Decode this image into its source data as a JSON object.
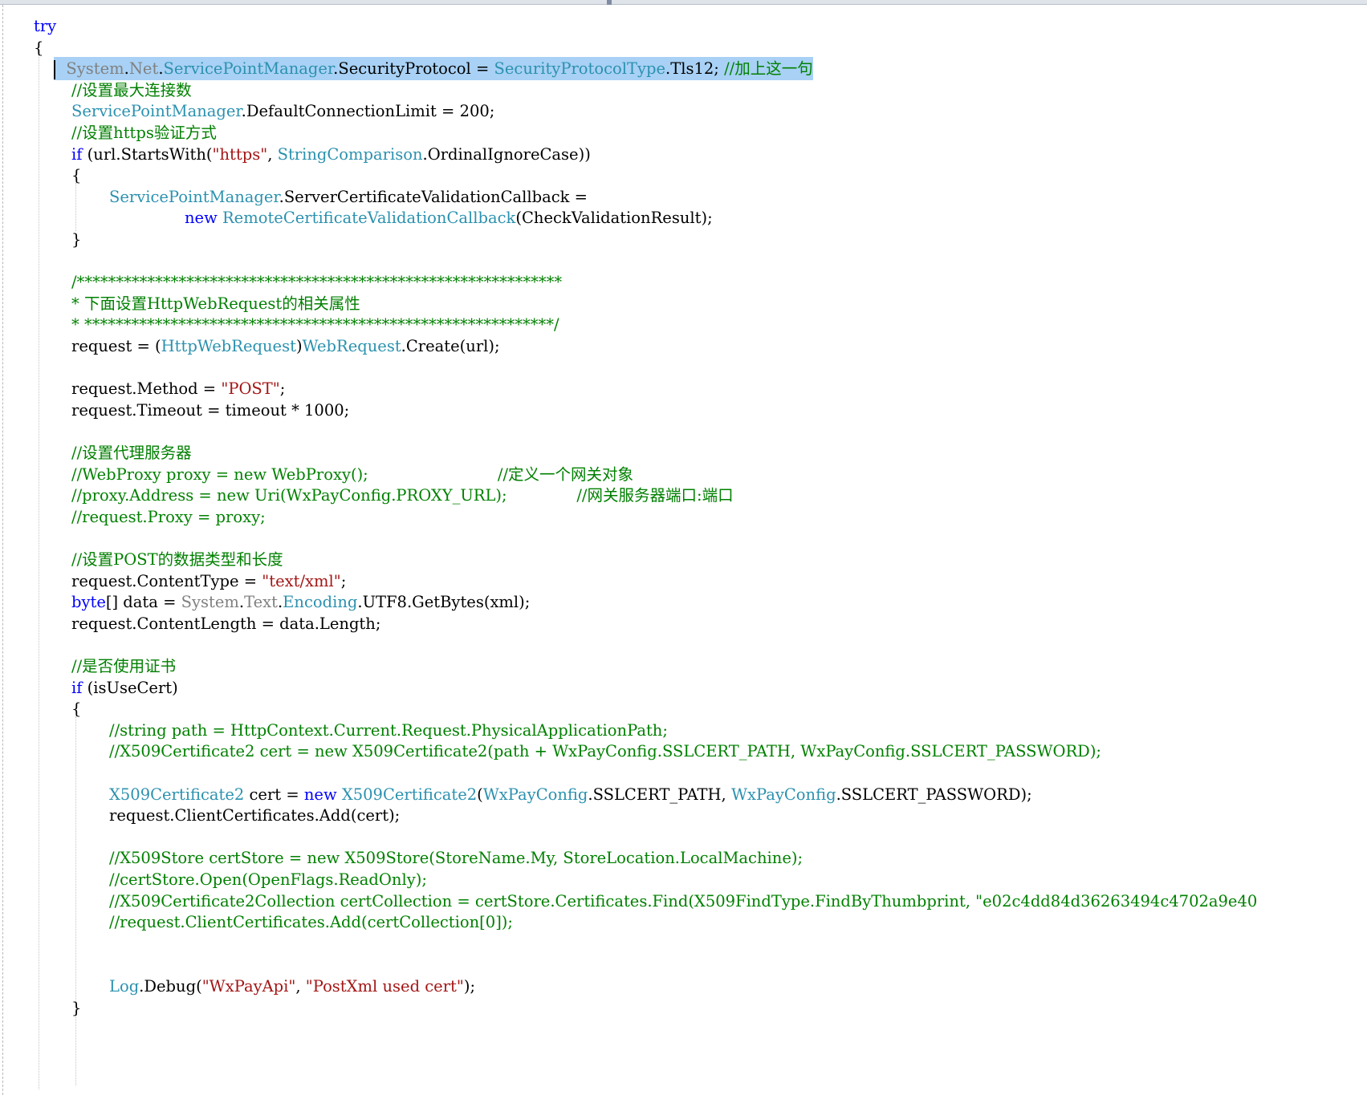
{
  "colors": {
    "keyword": "#0000ff",
    "type": "#2b91af",
    "string": "#a31515",
    "comment": "#008000",
    "namespace": "#808080",
    "plain": "#000000",
    "selection": "#a8d1f5",
    "background": "#ffffff"
  },
  "lines": [
    {
      "indent": 0,
      "segs": [
        {
          "t": "try",
          "c": "kw"
        }
      ]
    },
    {
      "indent": 0,
      "segs": [
        {
          "t": "{",
          "c": "pl"
        }
      ]
    },
    {
      "indent": 1,
      "selected": true,
      "caret": true,
      "segs": [
        {
          "t": "System",
          "c": "gr"
        },
        {
          "t": ".",
          "c": "pl"
        },
        {
          "t": "Net",
          "c": "gr"
        },
        {
          "t": ".",
          "c": "pl"
        },
        {
          "t": "ServicePointManager",
          "c": "ty"
        },
        {
          "t": ".SecurityProtocol = ",
          "c": "pl"
        },
        {
          "t": "SecurityProtocolType",
          "c": "ty"
        },
        {
          "t": ".Tls12; ",
          "c": "pl"
        },
        {
          "t": "//加上这一句",
          "c": "cm"
        }
      ]
    },
    {
      "indent": 1,
      "segs": [
        {
          "t": "//设置最大连接数",
          "c": "cm"
        }
      ]
    },
    {
      "indent": 1,
      "segs": [
        {
          "t": "ServicePointManager",
          "c": "ty"
        },
        {
          "t": ".DefaultConnectionLimit = 200;",
          "c": "pl"
        }
      ]
    },
    {
      "indent": 1,
      "segs": [
        {
          "t": "//设置https验证方式",
          "c": "cm"
        }
      ]
    },
    {
      "indent": 1,
      "segs": [
        {
          "t": "if",
          "c": "kw"
        },
        {
          "t": " (url.StartsWith(",
          "c": "pl"
        },
        {
          "t": "\"https\"",
          "c": "str"
        },
        {
          "t": ", ",
          "c": "pl"
        },
        {
          "t": "StringComparison",
          "c": "ty"
        },
        {
          "t": ".OrdinalIgnoreCase))",
          "c": "pl"
        }
      ]
    },
    {
      "indent": 1,
      "segs": [
        {
          "t": "{",
          "c": "pl"
        }
      ]
    },
    {
      "indent": 2,
      "segs": [
        {
          "t": "ServicePointManager",
          "c": "ty"
        },
        {
          "t": ".ServerCertificateValidationCallback =",
          "c": "pl"
        }
      ]
    },
    {
      "indent": 4,
      "segs": [
        {
          "t": "new",
          "c": "kw"
        },
        {
          "t": " ",
          "c": "pl"
        },
        {
          "t": "RemoteCertificateValidationCallback",
          "c": "ty"
        },
        {
          "t": "(CheckValidationResult);",
          "c": "pl"
        }
      ]
    },
    {
      "indent": 1,
      "segs": [
        {
          "t": "}",
          "c": "pl"
        }
      ]
    },
    {
      "indent": 1,
      "segs": []
    },
    {
      "indent": 1,
      "segs": [
        {
          "t": "/**************************************************************",
          "c": "cm"
        }
      ]
    },
    {
      "indent": 1,
      "segs": [
        {
          "t": "* 下面设置HttpWebRequest的相关属性",
          "c": "cm"
        }
      ]
    },
    {
      "indent": 1,
      "segs": [
        {
          "t": "* ************************************************************/",
          "c": "cm"
        }
      ]
    },
    {
      "indent": 1,
      "segs": [
        {
          "t": "request = (",
          "c": "pl"
        },
        {
          "t": "HttpWebRequest",
          "c": "ty"
        },
        {
          "t": ")",
          "c": "pl"
        },
        {
          "t": "WebRequest",
          "c": "ty"
        },
        {
          "t": ".Create(url);",
          "c": "pl"
        }
      ]
    },
    {
      "indent": 1,
      "segs": []
    },
    {
      "indent": 1,
      "segs": [
        {
          "t": "request.Method = ",
          "c": "pl"
        },
        {
          "t": "\"POST\"",
          "c": "str"
        },
        {
          "t": ";",
          "c": "pl"
        }
      ]
    },
    {
      "indent": 1,
      "segs": [
        {
          "t": "request.Timeout = timeout * 1000;",
          "c": "pl"
        }
      ]
    },
    {
      "indent": 1,
      "segs": []
    },
    {
      "indent": 1,
      "segs": [
        {
          "t": "//设置代理服务器",
          "c": "cm"
        }
      ]
    },
    {
      "indent": 1,
      "segs": [
        {
          "t": "//WebProxy proxy = new WebProxy();                          //定义一个网关对象",
          "c": "cm"
        }
      ]
    },
    {
      "indent": 1,
      "segs": [
        {
          "t": "//proxy.Address = new Uri(WxPayConfig.PROXY_URL);              //网关服务器端口:端口",
          "c": "cm"
        }
      ]
    },
    {
      "indent": 1,
      "segs": [
        {
          "t": "//request.Proxy = proxy;",
          "c": "cm"
        }
      ]
    },
    {
      "indent": 1,
      "segs": []
    },
    {
      "indent": 1,
      "segs": [
        {
          "t": "//设置POST的数据类型和长度",
          "c": "cm"
        }
      ]
    },
    {
      "indent": 1,
      "segs": [
        {
          "t": "request.ContentType = ",
          "c": "pl"
        },
        {
          "t": "\"text/xml\"",
          "c": "str"
        },
        {
          "t": ";",
          "c": "pl"
        }
      ]
    },
    {
      "indent": 1,
      "segs": [
        {
          "t": "byte",
          "c": "kw"
        },
        {
          "t": "[] data = ",
          "c": "pl"
        },
        {
          "t": "System",
          "c": "gr"
        },
        {
          "t": ".",
          "c": "pl"
        },
        {
          "t": "Text",
          "c": "gr"
        },
        {
          "t": ".",
          "c": "pl"
        },
        {
          "t": "Encoding",
          "c": "ty"
        },
        {
          "t": ".UTF8.GetBytes(xml);",
          "c": "pl"
        }
      ]
    },
    {
      "indent": 1,
      "segs": [
        {
          "t": "request.ContentLength = data.Length;",
          "c": "pl"
        }
      ]
    },
    {
      "indent": 1,
      "segs": []
    },
    {
      "indent": 1,
      "segs": [
        {
          "t": "//是否使用证书",
          "c": "cm"
        }
      ]
    },
    {
      "indent": 1,
      "segs": [
        {
          "t": "if",
          "c": "kw"
        },
        {
          "t": " (isUseCert)",
          "c": "pl"
        }
      ]
    },
    {
      "indent": 1,
      "segs": [
        {
          "t": "{",
          "c": "pl"
        }
      ]
    },
    {
      "indent": 2,
      "segs": [
        {
          "t": "//string path = HttpContext.Current.Request.PhysicalApplicationPath;",
          "c": "cm"
        }
      ]
    },
    {
      "indent": 2,
      "segs": [
        {
          "t": "//X509Certificate2 cert = new X509Certificate2(path + WxPayConfig.SSLCERT_PATH, WxPayConfig.SSLCERT_PASSWORD);",
          "c": "cm"
        }
      ]
    },
    {
      "indent": 2,
      "segs": []
    },
    {
      "indent": 2,
      "segs": [
        {
          "t": "X509Certificate2",
          "c": "ty"
        },
        {
          "t": " cert = ",
          "c": "pl"
        },
        {
          "t": "new",
          "c": "kw"
        },
        {
          "t": " ",
          "c": "pl"
        },
        {
          "t": "X509Certificate2",
          "c": "ty"
        },
        {
          "t": "(",
          "c": "pl"
        },
        {
          "t": "WxPayConfig",
          "c": "ty"
        },
        {
          "t": ".SSLCERT_PATH, ",
          "c": "pl"
        },
        {
          "t": "WxPayConfig",
          "c": "ty"
        },
        {
          "t": ".SSLCERT_PASSWORD);",
          "c": "pl"
        }
      ]
    },
    {
      "indent": 2,
      "segs": [
        {
          "t": "request.ClientCertificates.Add(cert);",
          "c": "pl"
        }
      ]
    },
    {
      "indent": 2,
      "segs": []
    },
    {
      "indent": 2,
      "segs": [
        {
          "t": "//X509Store certStore = new X509Store(StoreName.My, StoreLocation.LocalMachine);",
          "c": "cm"
        }
      ]
    },
    {
      "indent": 2,
      "segs": [
        {
          "t": "//certStore.Open(OpenFlags.ReadOnly);",
          "c": "cm"
        }
      ]
    },
    {
      "indent": 2,
      "segs": [
        {
          "t": "//X509Certificate2Collection certCollection = certStore.Certificates.Find(X509FindType.FindByThumbprint, \"e02c4dd84d36263494c4702a9e40",
          "c": "cm"
        }
      ]
    },
    {
      "indent": 2,
      "segs": [
        {
          "t": "//request.ClientCertificates.Add(certCollection[0]);",
          "c": "cm"
        }
      ]
    },
    {
      "indent": 2,
      "segs": []
    },
    {
      "indent": 2,
      "segs": []
    },
    {
      "indent": 2,
      "segs": [
        {
          "t": "Log",
          "c": "ty"
        },
        {
          "t": ".Debug(",
          "c": "pl"
        },
        {
          "t": "\"WxPayApi\"",
          "c": "str"
        },
        {
          "t": ", ",
          "c": "pl"
        },
        {
          "t": "\"PostXml used cert\"",
          "c": "str"
        },
        {
          "t": ");",
          "c": "pl"
        }
      ]
    },
    {
      "indent": 1,
      "segs": [
        {
          "t": "}",
          "c": "pl"
        }
      ]
    }
  ]
}
